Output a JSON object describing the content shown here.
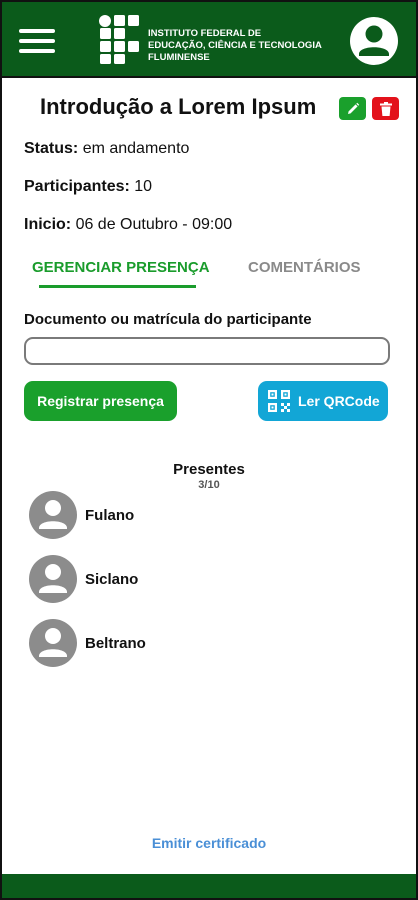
{
  "header": {
    "menu_icon": "hamburger-menu-icon",
    "logo_lines": [
      "INSTITUTO FEDERAL DE",
      "EDUCAÇÃO, CIÊNCIA E TECNOLOGIA",
      "FLUMINENSE"
    ],
    "profile_icon": "user-avatar-icon",
    "color": "#0b5b1b"
  },
  "event": {
    "title": "Introdução a Lorem Ipsum",
    "status_label": "Status:",
    "status_value": "em andamento",
    "participants_label": "Participantes:",
    "participants_value": "10",
    "start_label": "Inicio:",
    "start_value": "06 de Outubro - 09:00",
    "edit_icon": "pencil-icon",
    "delete_icon": "trash-icon"
  },
  "tabs": [
    {
      "label": "GERENCIAR PRESENÇA",
      "active": true
    },
    {
      "label": "COMENTÁRIOS",
      "active": false
    }
  ],
  "form": {
    "field_label": "Documento ou matrícula do participante",
    "field_value": "",
    "field_placeholder": "",
    "register_label": "Registrar presença",
    "qr_label": "Ler QRCode",
    "qr_icon": "qrcode-icon"
  },
  "presentes": {
    "title": "Presentes",
    "count": "3/10",
    "list": [
      {
        "name": "Fulano"
      },
      {
        "name": "Siclano"
      },
      {
        "name": "Beltrano"
      }
    ]
  },
  "certificate_label": "Emitir certificado",
  "colors": {
    "primary_green": "#1aa02c",
    "danger_red": "#e3121b",
    "qr_blue": "#12a6d6",
    "link_blue": "#4a8fd6"
  }
}
